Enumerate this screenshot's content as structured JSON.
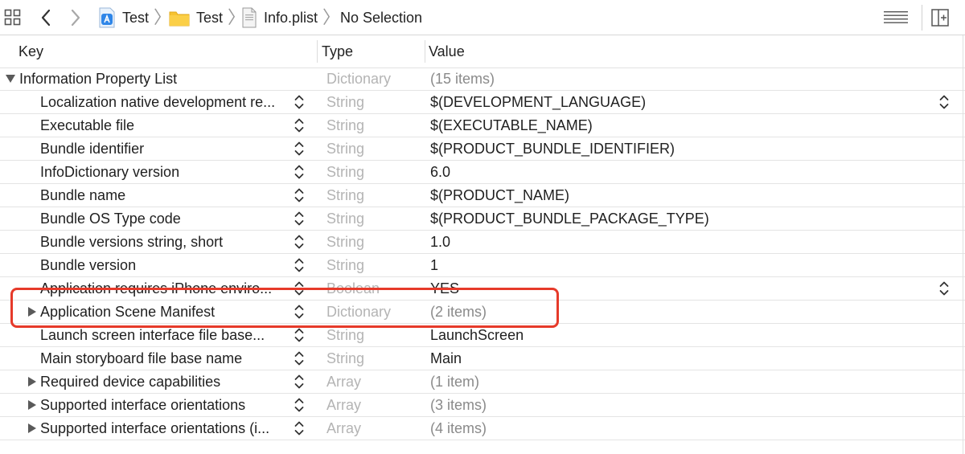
{
  "jumpbar": {
    "crumbs": [
      "Test",
      "Test",
      "Info.plist",
      "No Selection"
    ]
  },
  "header": {
    "key": "Key",
    "type": "Type",
    "value": "Value"
  },
  "root": {
    "key": "Information Property List",
    "type": "Dictionary",
    "value": "(15 items)"
  },
  "rows": [
    {
      "key": "Localization native development re...",
      "type": "String",
      "value": "$(DEVELOPMENT_LANGUAGE)",
      "expandable": false,
      "dim": false,
      "value_stepper": true
    },
    {
      "key": "Executable file",
      "type": "String",
      "value": "$(EXECUTABLE_NAME)",
      "expandable": false,
      "dim": false,
      "value_stepper": false
    },
    {
      "key": "Bundle identifier",
      "type": "String",
      "value": "$(PRODUCT_BUNDLE_IDENTIFIER)",
      "expandable": false,
      "dim": false,
      "value_stepper": false
    },
    {
      "key": "InfoDictionary version",
      "type": "String",
      "value": "6.0",
      "expandable": false,
      "dim": false,
      "value_stepper": false
    },
    {
      "key": "Bundle name",
      "type": "String",
      "value": "$(PRODUCT_NAME)",
      "expandable": false,
      "dim": false,
      "value_stepper": false
    },
    {
      "key": "Bundle OS Type code",
      "type": "String",
      "value": "$(PRODUCT_BUNDLE_PACKAGE_TYPE)",
      "expandable": false,
      "dim": false,
      "value_stepper": false
    },
    {
      "key": "Bundle versions string, short",
      "type": "String",
      "value": "1.0",
      "expandable": false,
      "dim": false,
      "value_stepper": false
    },
    {
      "key": "Bundle version",
      "type": "String",
      "value": "1",
      "expandable": false,
      "dim": false,
      "value_stepper": false
    },
    {
      "key": "Application requires iPhone enviro...",
      "type": "Boolean",
      "value": "YES",
      "expandable": false,
      "dim": false,
      "value_stepper": true
    },
    {
      "key": "Application Scene Manifest",
      "type": "Dictionary",
      "value": "(2 items)",
      "expandable": true,
      "dim": true,
      "value_stepper": false
    },
    {
      "key": "Launch screen interface file base...",
      "type": "String",
      "value": "LaunchScreen",
      "expandable": false,
      "dim": false,
      "value_stepper": false
    },
    {
      "key": "Main storyboard file base name",
      "type": "String",
      "value": "Main",
      "expandable": false,
      "dim": false,
      "value_stepper": false
    },
    {
      "key": "Required device capabilities",
      "type": "Array",
      "value": "(1 item)",
      "expandable": true,
      "dim": true,
      "value_stepper": false
    },
    {
      "key": "Supported interface orientations",
      "type": "Array",
      "value": "(3 items)",
      "expandable": true,
      "dim": true,
      "value_stepper": false
    },
    {
      "key": "Supported interface orientations (i...",
      "type": "Array",
      "value": "(4 items)",
      "expandable": true,
      "dim": true,
      "value_stepper": false
    }
  ],
  "icons": {
    "grid": "grid-icon",
    "back": "chevron-left-icon",
    "forward": "chevron-right-icon",
    "project": "xcode-project-icon",
    "folder": "folder-icon",
    "file": "plist-file-icon",
    "menu": "lines-menu-icon",
    "add_editor": "add-editor-icon"
  },
  "colors": {
    "highlight_box": "#e63a2a",
    "folder": "#f7c331",
    "project": "#2f86e8"
  }
}
